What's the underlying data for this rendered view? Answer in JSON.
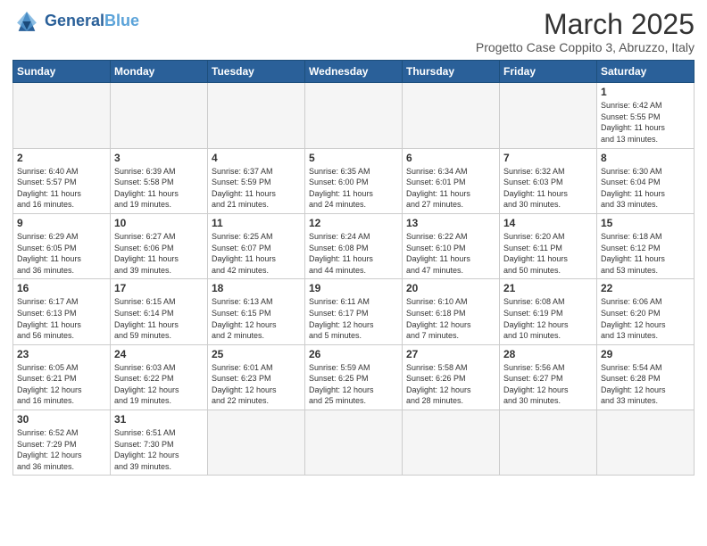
{
  "header": {
    "logo_general": "General",
    "logo_blue": "Blue",
    "title": "March 2025",
    "subtitle": "Progetto Case Coppito 3, Abruzzo, Italy"
  },
  "days_of_week": [
    "Sunday",
    "Monday",
    "Tuesday",
    "Wednesday",
    "Thursday",
    "Friday",
    "Saturday"
  ],
  "weeks": [
    {
      "cells": [
        {
          "day": "",
          "info": "",
          "empty": true
        },
        {
          "day": "",
          "info": "",
          "empty": true
        },
        {
          "day": "",
          "info": "",
          "empty": true
        },
        {
          "day": "",
          "info": "",
          "empty": true
        },
        {
          "day": "",
          "info": "",
          "empty": true
        },
        {
          "day": "",
          "info": "",
          "empty": true
        },
        {
          "day": "1",
          "info": "Sunrise: 6:42 AM\nSunset: 5:55 PM\nDaylight: 11 hours\nand 13 minutes."
        }
      ]
    },
    {
      "cells": [
        {
          "day": "2",
          "info": "Sunrise: 6:40 AM\nSunset: 5:57 PM\nDaylight: 11 hours\nand 16 minutes."
        },
        {
          "day": "3",
          "info": "Sunrise: 6:39 AM\nSunset: 5:58 PM\nDaylight: 11 hours\nand 19 minutes."
        },
        {
          "day": "4",
          "info": "Sunrise: 6:37 AM\nSunset: 5:59 PM\nDaylight: 11 hours\nand 21 minutes."
        },
        {
          "day": "5",
          "info": "Sunrise: 6:35 AM\nSunset: 6:00 PM\nDaylight: 11 hours\nand 24 minutes."
        },
        {
          "day": "6",
          "info": "Sunrise: 6:34 AM\nSunset: 6:01 PM\nDaylight: 11 hours\nand 27 minutes."
        },
        {
          "day": "7",
          "info": "Sunrise: 6:32 AM\nSunset: 6:03 PM\nDaylight: 11 hours\nand 30 minutes."
        },
        {
          "day": "8",
          "info": "Sunrise: 6:30 AM\nSunset: 6:04 PM\nDaylight: 11 hours\nand 33 minutes."
        }
      ]
    },
    {
      "cells": [
        {
          "day": "9",
          "info": "Sunrise: 6:29 AM\nSunset: 6:05 PM\nDaylight: 11 hours\nand 36 minutes."
        },
        {
          "day": "10",
          "info": "Sunrise: 6:27 AM\nSunset: 6:06 PM\nDaylight: 11 hours\nand 39 minutes."
        },
        {
          "day": "11",
          "info": "Sunrise: 6:25 AM\nSunset: 6:07 PM\nDaylight: 11 hours\nand 42 minutes."
        },
        {
          "day": "12",
          "info": "Sunrise: 6:24 AM\nSunset: 6:08 PM\nDaylight: 11 hours\nand 44 minutes."
        },
        {
          "day": "13",
          "info": "Sunrise: 6:22 AM\nSunset: 6:10 PM\nDaylight: 11 hours\nand 47 minutes."
        },
        {
          "day": "14",
          "info": "Sunrise: 6:20 AM\nSunset: 6:11 PM\nDaylight: 11 hours\nand 50 minutes."
        },
        {
          "day": "15",
          "info": "Sunrise: 6:18 AM\nSunset: 6:12 PM\nDaylight: 11 hours\nand 53 minutes."
        }
      ]
    },
    {
      "cells": [
        {
          "day": "16",
          "info": "Sunrise: 6:17 AM\nSunset: 6:13 PM\nDaylight: 11 hours\nand 56 minutes."
        },
        {
          "day": "17",
          "info": "Sunrise: 6:15 AM\nSunset: 6:14 PM\nDaylight: 11 hours\nand 59 minutes."
        },
        {
          "day": "18",
          "info": "Sunrise: 6:13 AM\nSunset: 6:15 PM\nDaylight: 12 hours\nand 2 minutes."
        },
        {
          "day": "19",
          "info": "Sunrise: 6:11 AM\nSunset: 6:17 PM\nDaylight: 12 hours\nand 5 minutes."
        },
        {
          "day": "20",
          "info": "Sunrise: 6:10 AM\nSunset: 6:18 PM\nDaylight: 12 hours\nand 7 minutes."
        },
        {
          "day": "21",
          "info": "Sunrise: 6:08 AM\nSunset: 6:19 PM\nDaylight: 12 hours\nand 10 minutes."
        },
        {
          "day": "22",
          "info": "Sunrise: 6:06 AM\nSunset: 6:20 PM\nDaylight: 12 hours\nand 13 minutes."
        }
      ]
    },
    {
      "cells": [
        {
          "day": "23",
          "info": "Sunrise: 6:05 AM\nSunset: 6:21 PM\nDaylight: 12 hours\nand 16 minutes."
        },
        {
          "day": "24",
          "info": "Sunrise: 6:03 AM\nSunset: 6:22 PM\nDaylight: 12 hours\nand 19 minutes."
        },
        {
          "day": "25",
          "info": "Sunrise: 6:01 AM\nSunset: 6:23 PM\nDaylight: 12 hours\nand 22 minutes."
        },
        {
          "day": "26",
          "info": "Sunrise: 5:59 AM\nSunset: 6:25 PM\nDaylight: 12 hours\nand 25 minutes."
        },
        {
          "day": "27",
          "info": "Sunrise: 5:58 AM\nSunset: 6:26 PM\nDaylight: 12 hours\nand 28 minutes."
        },
        {
          "day": "28",
          "info": "Sunrise: 5:56 AM\nSunset: 6:27 PM\nDaylight: 12 hours\nand 30 minutes."
        },
        {
          "day": "29",
          "info": "Sunrise: 5:54 AM\nSunset: 6:28 PM\nDaylight: 12 hours\nand 33 minutes."
        }
      ]
    },
    {
      "cells": [
        {
          "day": "30",
          "info": "Sunrise: 6:52 AM\nSunset: 7:29 PM\nDaylight: 12 hours\nand 36 minutes."
        },
        {
          "day": "31",
          "info": "Sunrise: 6:51 AM\nSunset: 7:30 PM\nDaylight: 12 hours\nand 39 minutes."
        },
        {
          "day": "",
          "info": "",
          "empty": true
        },
        {
          "day": "",
          "info": "",
          "empty": true
        },
        {
          "day": "",
          "info": "",
          "empty": true
        },
        {
          "day": "",
          "info": "",
          "empty": true
        },
        {
          "day": "",
          "info": "",
          "empty": true
        }
      ]
    }
  ]
}
